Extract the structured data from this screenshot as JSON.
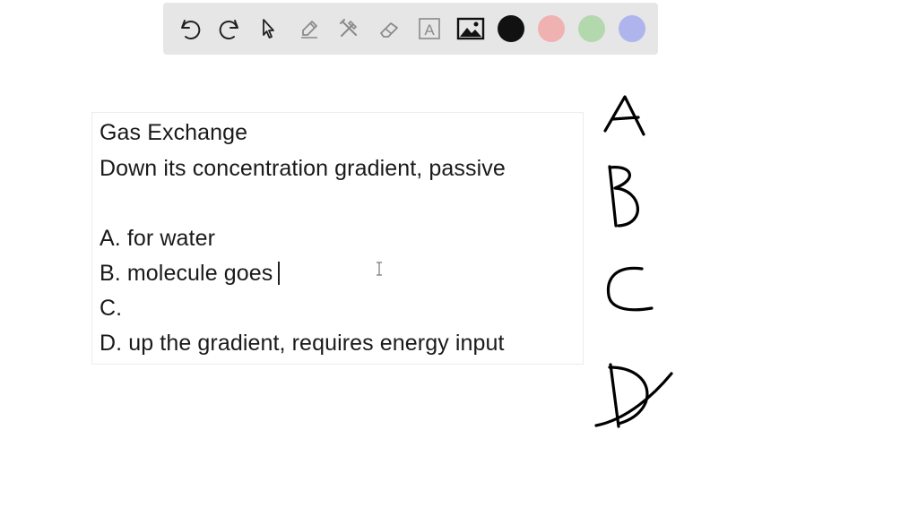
{
  "toolbar": {
    "tools": [
      {
        "icon": "undo-icon"
      },
      {
        "icon": "redo-icon"
      },
      {
        "icon": "pointer-icon"
      },
      {
        "icon": "pen-icon"
      },
      {
        "icon": "tools-icon"
      },
      {
        "icon": "eraser-icon"
      },
      {
        "icon": "text-tool-icon",
        "glyph": "A"
      },
      {
        "icon": "image-icon"
      }
    ],
    "colors": {
      "black": "#111111",
      "red": "#f0b1b1",
      "green": "#b4d8ae",
      "blue": "#aeb4ec",
      "toolbar_bg": "#e6e6e6"
    }
  },
  "textbox": {
    "lines": [
      "Gas Exchange",
      "Down its concentration gradient, passive",
      "",
      "A. for water",
      "B. molecule goes",
      "C.",
      "D. up the gradient, requires energy input"
    ]
  },
  "handwriting": {
    "letters": [
      "A",
      "B",
      "C",
      "D"
    ],
    "ink_color": "#000000"
  }
}
